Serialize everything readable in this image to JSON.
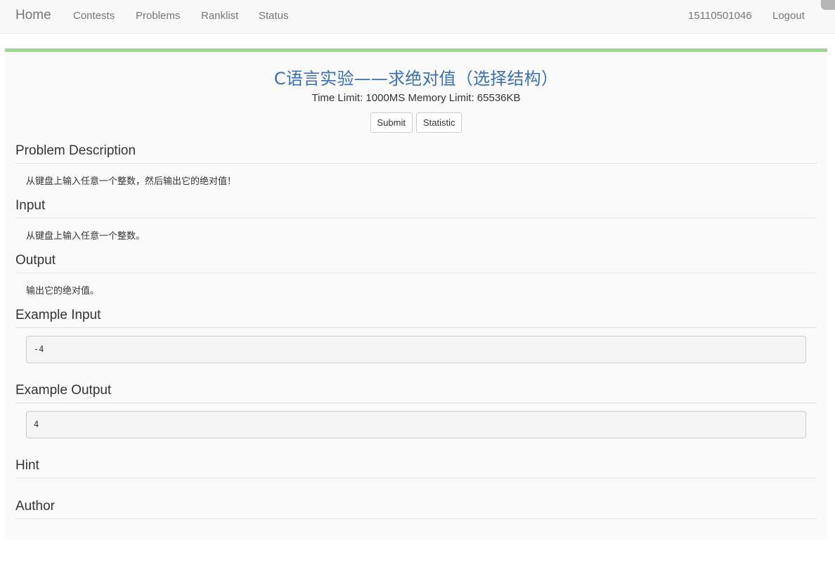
{
  "nav": {
    "brand": "Home",
    "links": [
      "Contests",
      "Problems",
      "Ranklist",
      "Status"
    ],
    "user": "15110501046",
    "logout": "Logout"
  },
  "problem": {
    "title": "C语言实验——求绝对值（选择结构）",
    "limits": "Time Limit: 1000MS Memory Limit: 65536KB",
    "submit_label": "Submit",
    "statistic_label": "Statistic",
    "description_heading": "Problem Description",
    "description": "从键盘上输入任意一个整数，然后输出它的绝对值！",
    "input_heading": "Input",
    "input": "从键盘上输入任意一个整数。",
    "output_heading": "Output",
    "output": "输出它的绝对值。",
    "example_input_heading": "Example Input",
    "example_input": "-4",
    "example_output_heading": "Example Output",
    "example_output": "4",
    "hint_heading": "Hint",
    "author_heading": "Author"
  },
  "colors": {
    "accent_bar": "#9ad98f",
    "title": "#3a6fb0"
  }
}
